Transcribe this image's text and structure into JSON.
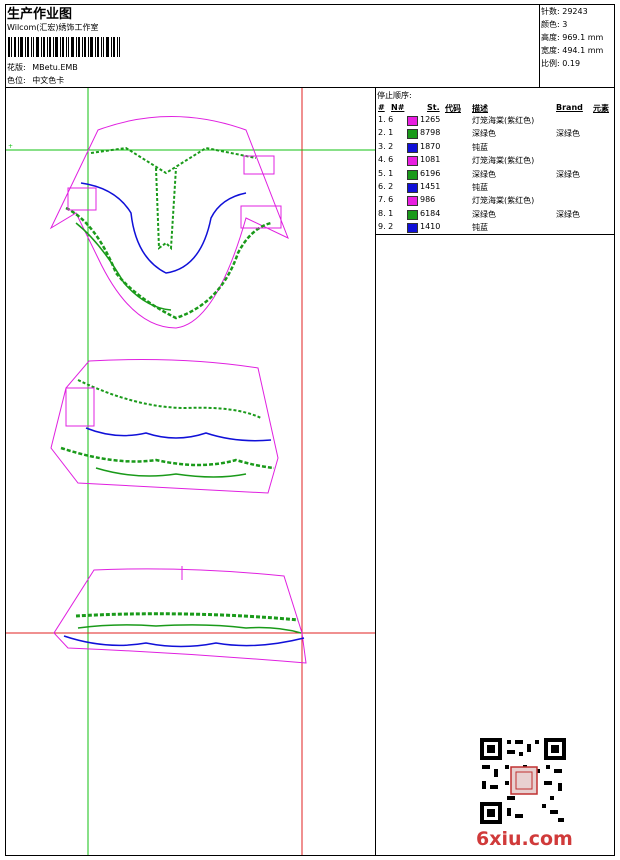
{
  "header": {
    "title": "生产作业图",
    "subtitle": "Wilcom(汇宏)绣饰工作室",
    "design_label": "花版:",
    "design_value": "MBetu.EMB",
    "color_label": "色位:",
    "color_value": "中文色卡"
  },
  "stats": {
    "stitches_label": "针数:",
    "stitches_value": "29243",
    "colors_label": "颜色:",
    "colors_value": "3",
    "height_label": "高度:",
    "height_value": "969.1 mm",
    "width_label": "宽度:",
    "width_value": "494.1 mm",
    "scale_label": "比例:",
    "scale_value": "0.19"
  },
  "stop_sequence": {
    "title": "停止顺序:",
    "columns": [
      "#",
      "N#",
      "St.",
      "代码",
      "描述",
      "Brand",
      "元素"
    ],
    "rows": [
      {
        "seq": "1. 6",
        "code": "1265",
        "color": "#e81ee0",
        "desc": "灯笼海棠(紫红色)",
        "brand": ""
      },
      {
        "seq": "2. 1",
        "code": "8798",
        "color": "#1a9a1a",
        "desc": "深绿色",
        "brand": "深绿色"
      },
      {
        "seq": "3. 2",
        "code": "1870",
        "color": "#1010d8",
        "desc": "钝蓝",
        "brand": ""
      },
      {
        "seq": "4. 6",
        "code": "1081",
        "color": "#e81ee0",
        "desc": "灯笼海棠(紫红色)",
        "brand": ""
      },
      {
        "seq": "5. 1",
        "code": "6196",
        "color": "#1a9a1a",
        "desc": "深绿色",
        "brand": "深绿色"
      },
      {
        "seq": "6. 2",
        "code": "1451",
        "color": "#1010d8",
        "desc": "钝蓝",
        "brand": ""
      },
      {
        "seq": "7. 6",
        "code": "986",
        "color": "#e81ee0",
        "desc": "灯笼海棠(紫红色)",
        "brand": ""
      },
      {
        "seq": "8. 1",
        "code": "6184",
        "color": "#1a9a1a",
        "desc": "深绿色",
        "brand": "深绿色"
      },
      {
        "seq": "9. 2",
        "code": "1410",
        "color": "#1010d8",
        "desc": "钝蓝",
        "brand": ""
      }
    ]
  },
  "footer": {
    "logo_text": "6xiu.com"
  },
  "colors": {
    "outline": "#e020e0",
    "fill": "#1a9a1a",
    "accent": "#1010d8",
    "guide_red": "#e02020",
    "guide_green": "#10c010"
  }
}
